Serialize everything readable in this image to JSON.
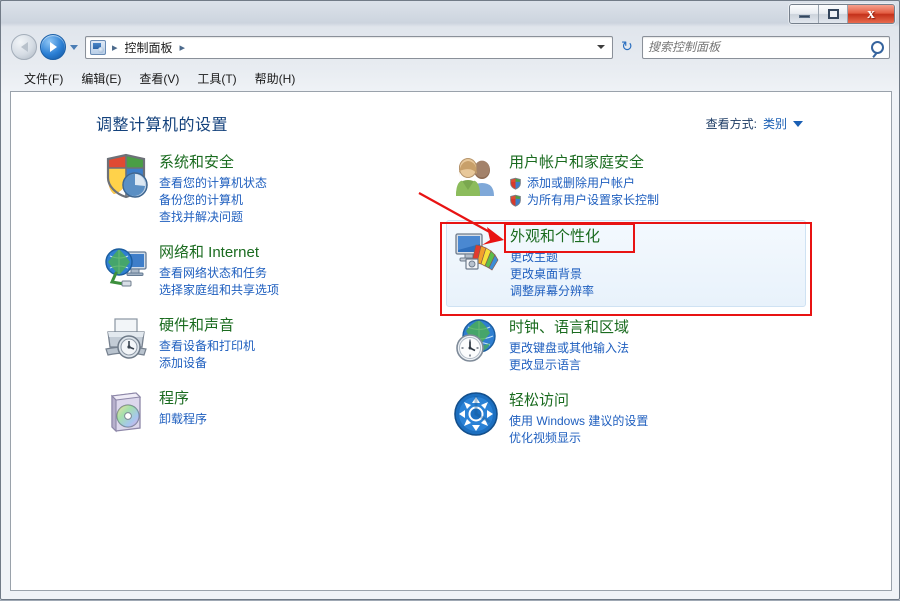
{
  "window": {
    "controls": [
      {
        "name": "minimize",
        "glyph": "minimize-icon"
      },
      {
        "name": "maximize",
        "glyph": "maximize-icon"
      },
      {
        "name": "close",
        "glyph": "close-icon",
        "label": "x",
        "color": "#c3311a"
      }
    ]
  },
  "nav": {
    "back_label": "back-arrow-icon",
    "forward_label": "forward-arrow-icon",
    "history_dropdown": "chevron-down-icon",
    "breadcrumb_icon": "control-panel-icon",
    "breadcrumb": "控制面板",
    "separator": "▸",
    "refresh_glyph": "↻",
    "address_caret": "chevron-down-icon"
  },
  "search": {
    "placeholder": "搜索控制面板",
    "value": "",
    "icon": "search-icon"
  },
  "menu": {
    "items": [
      {
        "label": "文件(F)"
      },
      {
        "label": "编辑(E)"
      },
      {
        "label": "查看(V)"
      },
      {
        "label": "工具(T)"
      },
      {
        "label": "帮助(H)"
      }
    ]
  },
  "page": {
    "title": "调整计算机的设置",
    "viewby_label": "查看方式:",
    "viewby_value": "类别"
  },
  "colors": {
    "category_title": "#1a6b1f",
    "link": "#1f5fbf",
    "heading": "#14427c",
    "annotation": "#e81313",
    "highlight_bg": "#e8f2fb"
  },
  "categories": {
    "left": [
      {
        "icon": "security-shield-icon",
        "title": "系统和安全",
        "links": [
          {
            "label": "查看您的计算机状态",
            "shield": false
          },
          {
            "label": "备份您的计算机",
            "shield": false
          },
          {
            "label": "查找并解决问题",
            "shield": false
          }
        ]
      },
      {
        "icon": "network-globe-icon",
        "title": "网络和 Internet",
        "links": [
          {
            "label": "查看网络状态和任务",
            "shield": false
          },
          {
            "label": "选择家庭组和共享选项",
            "shield": false
          }
        ]
      },
      {
        "icon": "printer-hardware-icon",
        "title": "硬件和声音",
        "links": [
          {
            "label": "查看设备和打印机",
            "shield": false
          },
          {
            "label": "添加设备",
            "shield": false
          }
        ]
      },
      {
        "icon": "programs-box-icon",
        "title": "程序",
        "links": [
          {
            "label": "卸载程序",
            "shield": false
          }
        ]
      }
    ],
    "right": [
      {
        "icon": "user-accounts-icon",
        "title": "用户帐户和家庭安全",
        "links": [
          {
            "label": "添加或删除用户帐户",
            "shield": true
          },
          {
            "label": "为所有用户设置家长控制",
            "shield": true
          }
        ]
      },
      {
        "icon": "appearance-monitor-icon",
        "title": "外观和个性化",
        "highlighted": true,
        "links": [
          {
            "label": "更改主题",
            "shield": false
          },
          {
            "label": "更改桌面背景",
            "shield": false
          },
          {
            "label": "调整屏幕分辨率",
            "shield": false
          }
        ]
      },
      {
        "icon": "clock-globe-icon",
        "title": "时钟、语言和区域",
        "links": [
          {
            "label": "更改键盘或其他输入法",
            "shield": false
          },
          {
            "label": "更改显示语言",
            "shield": false
          }
        ]
      },
      {
        "icon": "ease-of-access-icon",
        "title": "轻松访问",
        "links": [
          {
            "label": "使用 Windows 建议的设置",
            "shield": false
          },
          {
            "label": "优化视频显示",
            "shield": false
          }
        ]
      }
    ]
  },
  "annotations": {
    "outer_box_target": "外观和个性化",
    "inner_box_target": "外观和个性化",
    "arrow_points_to": "外观和个性化"
  }
}
